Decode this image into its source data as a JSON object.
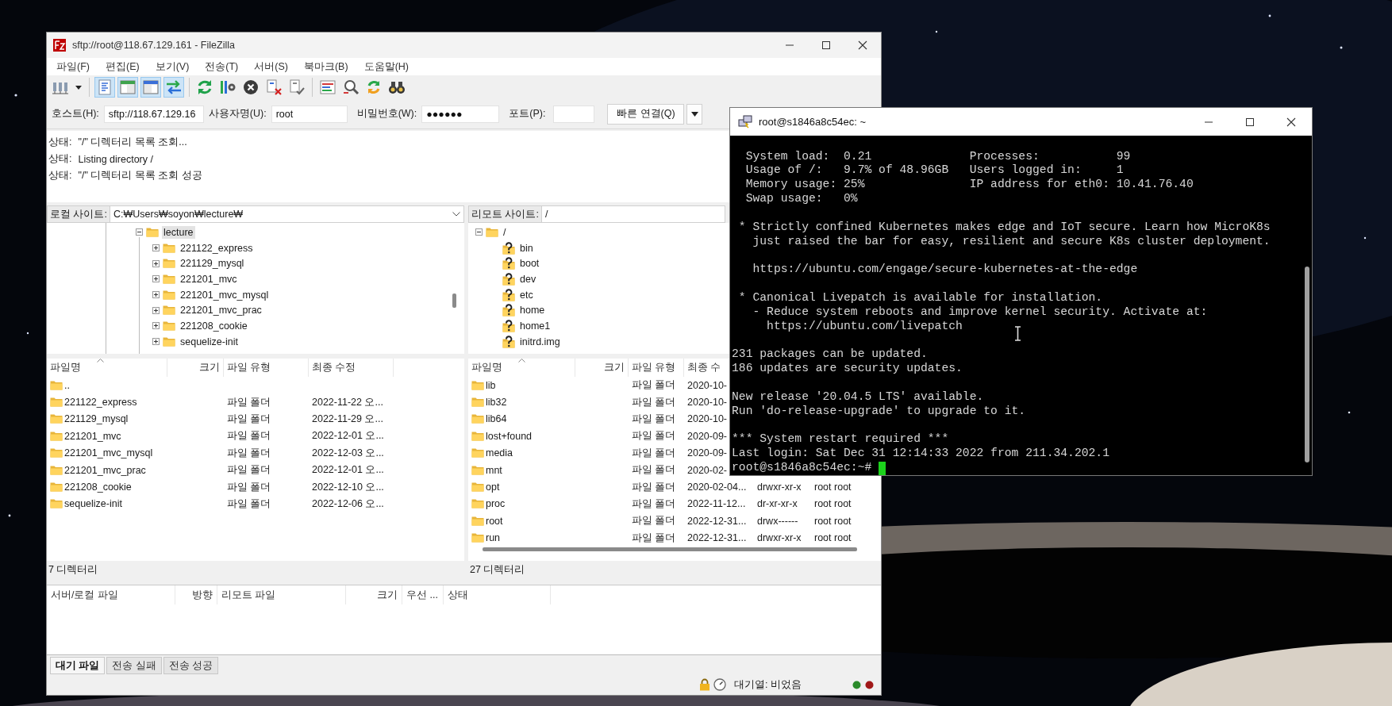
{
  "filezilla": {
    "title": "sftp://root@118.67.129.161 - FileZilla",
    "menu": [
      "파일(F)",
      "편집(E)",
      "보기(V)",
      "전송(T)",
      "서버(S)",
      "북마크(B)",
      "도움말(H)"
    ],
    "toolbar": [
      {
        "kind": "site-manager",
        "pressed": false
      },
      {
        "kind": "dropdown",
        "pressed": false
      },
      {
        "kind": "message-log",
        "pressed": true
      },
      {
        "kind": "local-tree",
        "pressed": true
      },
      {
        "kind": "remote-tree",
        "pressed": true
      },
      {
        "kind": "queue",
        "pressed": true
      },
      {
        "kind": "refresh",
        "pressed": false
      },
      {
        "kind": "process-queue",
        "pressed": false
      },
      {
        "kind": "cancel",
        "pressed": false
      },
      {
        "kind": "disconnect",
        "pressed": false
      },
      {
        "kind": "reconnect",
        "pressed": false
      },
      {
        "kind": "filter",
        "pressed": false
      },
      {
        "kind": "compare",
        "pressed": false
      },
      {
        "kind": "sync",
        "pressed": false
      },
      {
        "kind": "search",
        "pressed": false
      }
    ],
    "quickconnect": {
      "host_label": "호스트(H):",
      "host": "sftp://118.67.129.16",
      "user_label": "사용자명(U):",
      "user": "root",
      "password_label": "비밀번호(W):",
      "password": "●●●●●●",
      "port_label": "포트(P):",
      "button": "빠른 연결(Q)"
    },
    "log": [
      {
        "label": "상태:",
        "message": "\"/\" 디렉터리 목록 조회..."
      },
      {
        "label": "상태:",
        "message": "Listing directory /"
      },
      {
        "label": "상태:",
        "message": "\"/\" 디렉터리 목록 조회 성공"
      }
    ],
    "local": {
      "site_label": "로컬 사이트:",
      "path": "C:₩Users₩soyon₩lecture₩",
      "tree": [
        {
          "label": "lecture",
          "expanded": true,
          "selected": true,
          "children": [
            {
              "label": "221122_express",
              "expanded": false,
              "selected": false
            },
            {
              "label": "221129_mysql",
              "expanded": false,
              "selected": false
            },
            {
              "label": "221201_mvc",
              "expanded": false,
              "selected": false
            },
            {
              "label": "221201_mvc_mysql",
              "expanded": false,
              "selected": false
            },
            {
              "label": "221201_mvc_prac",
              "expanded": false,
              "selected": false
            },
            {
              "label": "221208_cookie",
              "expanded": false,
              "selected": false
            },
            {
              "label": "sequelize-init",
              "expanded": false,
              "selected": false
            }
          ]
        }
      ],
      "columns": [
        "파일명",
        "크기",
        "파일 유형",
        "최종 수정"
      ],
      "rows": [
        {
          "name": ".."
        },
        {
          "name": "221122_express",
          "type": "파일 폴더",
          "modified": "2022-11-22 오..."
        },
        {
          "name": "221129_mysql",
          "type": "파일 폴더",
          "modified": "2022-11-29 오..."
        },
        {
          "name": "221201_mvc",
          "type": "파일 폴더",
          "modified": "2022-12-01 오..."
        },
        {
          "name": "221201_mvc_mysql",
          "type": "파일 폴더",
          "modified": "2022-12-03 오..."
        },
        {
          "name": "221201_mvc_prac",
          "type": "파일 폴더",
          "modified": "2022-12-01 오..."
        },
        {
          "name": "221208_cookie",
          "type": "파일 폴더",
          "modified": "2022-12-10 오..."
        },
        {
          "name": "sequelize-init",
          "type": "파일 폴더",
          "modified": "2022-12-06 오..."
        }
      ],
      "status": "7 디렉터리"
    },
    "remote": {
      "site_label": "리모트 사이트:",
      "path": "/",
      "tree": [
        {
          "label": "/",
          "expanded": true,
          "children": [
            {
              "label": "bin"
            },
            {
              "label": "boot"
            },
            {
              "label": "dev"
            },
            {
              "label": "etc"
            },
            {
              "label": "home"
            },
            {
              "label": "home1"
            },
            {
              "label": "initrd.img"
            }
          ]
        }
      ],
      "columns": [
        "파일명",
        "크기",
        "파일 유형",
        "최종 수"
      ],
      "rows": [
        {
          "name": "lib",
          "type": "파일 폴더",
          "modified": "2020-10-"
        },
        {
          "name": "lib32",
          "type": "파일 폴더",
          "modified": "2020-10-"
        },
        {
          "name": "lib64",
          "type": "파일 폴더",
          "modified": "2020-10-"
        },
        {
          "name": "lost+found",
          "type": "파일 폴더",
          "modified": "2020-09-"
        },
        {
          "name": "media",
          "type": "파일 폴더",
          "modified": "2020-09-"
        },
        {
          "name": "mnt",
          "type": "파일 폴더",
          "modified": "2020-02-"
        },
        {
          "name": "opt",
          "type": "파일 폴더",
          "modified": "2020-02-04...",
          "permissions": "drwxr-xr-x",
          "owner": "root root"
        },
        {
          "name": "proc",
          "type": "파일 폴더",
          "modified": "2022-11-12...",
          "permissions": "dr-xr-xr-x",
          "owner": "root root"
        },
        {
          "name": "root",
          "type": "파일 폴더",
          "modified": "2022-12-31...",
          "permissions": "drwx------",
          "owner": "root root"
        },
        {
          "name": "run",
          "type": "파일 폴더",
          "modified": "2022-12-31...",
          "permissions": "drwxr-xr-x",
          "owner": "root root"
        }
      ],
      "status": "27 디렉터리"
    },
    "queue": {
      "columns": [
        "서버/로컬 파일",
        "방향",
        "리모트 파일",
        "크기",
        "우선 ...",
        "상태"
      ],
      "tabs": [
        {
          "label": "대기 파일",
          "selected": true
        },
        {
          "label": "전송 실패",
          "selected": false
        },
        {
          "label": "전송 성공",
          "selected": false
        }
      ]
    },
    "status_bar": {
      "queue": "대기열: 비었음"
    }
  },
  "terminal": {
    "title": "root@s1846a8c54ec: ~",
    "blocks": [
      [
        "  System load:  0.21              Processes:           99",
        "  Usage of /:   9.7% of 48.96GB   Users logged in:     1",
        "  Memory usage: 25%               IP address for eth0: 10.41.76.40",
        "  Swap usage:   0%"
      ],
      [
        " * Strictly confined Kubernetes makes edge and IoT secure. Learn how MicroK8s",
        "   just raised the bar for easy, resilient and secure K8s cluster deployment."
      ],
      [
        "   https://ubuntu.com/engage/secure-kubernetes-at-the-edge"
      ],
      [
        " * Canonical Livepatch is available for installation.",
        "   - Reduce system reboots and improve kernel security. Activate at:",
        "     https://ubuntu.com/livepatch"
      ],
      [
        "231 packages can be updated.",
        "186 updates are security updates."
      ],
      [
        "New release '20.04.5 LTS' available.",
        "Run 'do-release-upgrade' to upgrade to it."
      ],
      [
        "*** System restart required ***",
        "Last login: Sat Dec 31 12:14:33 2022 from 211.34.202.1",
        "root@s1846a8c54ec:~#"
      ]
    ]
  }
}
